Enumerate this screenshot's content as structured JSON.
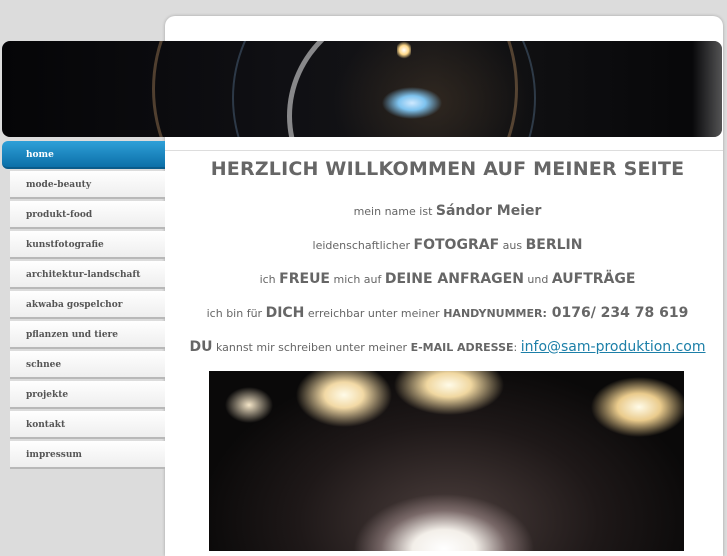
{
  "nav": {
    "items": [
      {
        "label": "home",
        "active": true
      },
      {
        "label": "mode-beauty"
      },
      {
        "label": "produkt-food"
      },
      {
        "label": "kunstfotografie"
      },
      {
        "label": "architektur-landschaft"
      },
      {
        "label": "akwaba gospelchor"
      },
      {
        "label": "pflanzen und tiere"
      },
      {
        "label": "schnee"
      },
      {
        "label": "projekte"
      },
      {
        "label": "kontakt"
      },
      {
        "label": "impressum"
      }
    ]
  },
  "content": {
    "heading": "HERZLICH WILLKOMMEN AUF MEINER SEITE",
    "line1": {
      "a": "mein name ist ",
      "b": "Sándor Meier"
    },
    "line2": {
      "a": "leidenschaftlicher ",
      "b": "FOTOGRAF",
      "c": " aus ",
      "d": "BERLIN"
    },
    "line3": {
      "a": "ich ",
      "b": "FREUE",
      "c": " mich auf ",
      "d": "DEINE ANFRAGEN",
      "e": " und ",
      "f": "AUFTRÄGE"
    },
    "line4": {
      "a": "ich bin für ",
      "b": "DICH",
      "c": " erreichbar unter meiner ",
      "d": "HANDYNUMMER:",
      "e": " 0176/ 234 78 619"
    },
    "line5": {
      "a": "DU",
      "b": " kannst mir schreiben unter meiner ",
      "c": "E-MAIL ADRESSE",
      "d": ": ",
      "email": "info@sam-produktion.com"
    }
  },
  "colors": {
    "accent": "#1a8ac4",
    "link": "#1c7fa8",
    "text": "#666666",
    "background": "#dcdcdc"
  }
}
